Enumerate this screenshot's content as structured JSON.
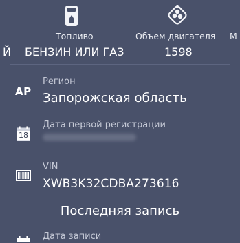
{
  "specs": {
    "left_partial_value": "Й",
    "fuel": {
      "label": "Топливо",
      "value": "БЕНЗИН ИЛИ ГАЗ",
      "icon": "fuel-icon"
    },
    "engine": {
      "label": "Объем двигателя",
      "value": "1598",
      "icon": "engine-icon"
    },
    "right_partial_label": "М"
  },
  "details": {
    "region": {
      "badge": "АР",
      "label": "Регион",
      "value": "Запорожская область"
    },
    "first_registration": {
      "calendar_day": "18",
      "label": "Дата первой регистрации"
    },
    "vin": {
      "label": "VIN",
      "value": "XWB3K32CDBA273616",
      "icon": "barcode-icon"
    }
  },
  "last_record": {
    "title": "Последняя запись",
    "date_label": "Дата записи"
  },
  "colors": {
    "background": "#49516a",
    "divider": "#5d6580",
    "muted_text": "#c5c9d6"
  }
}
